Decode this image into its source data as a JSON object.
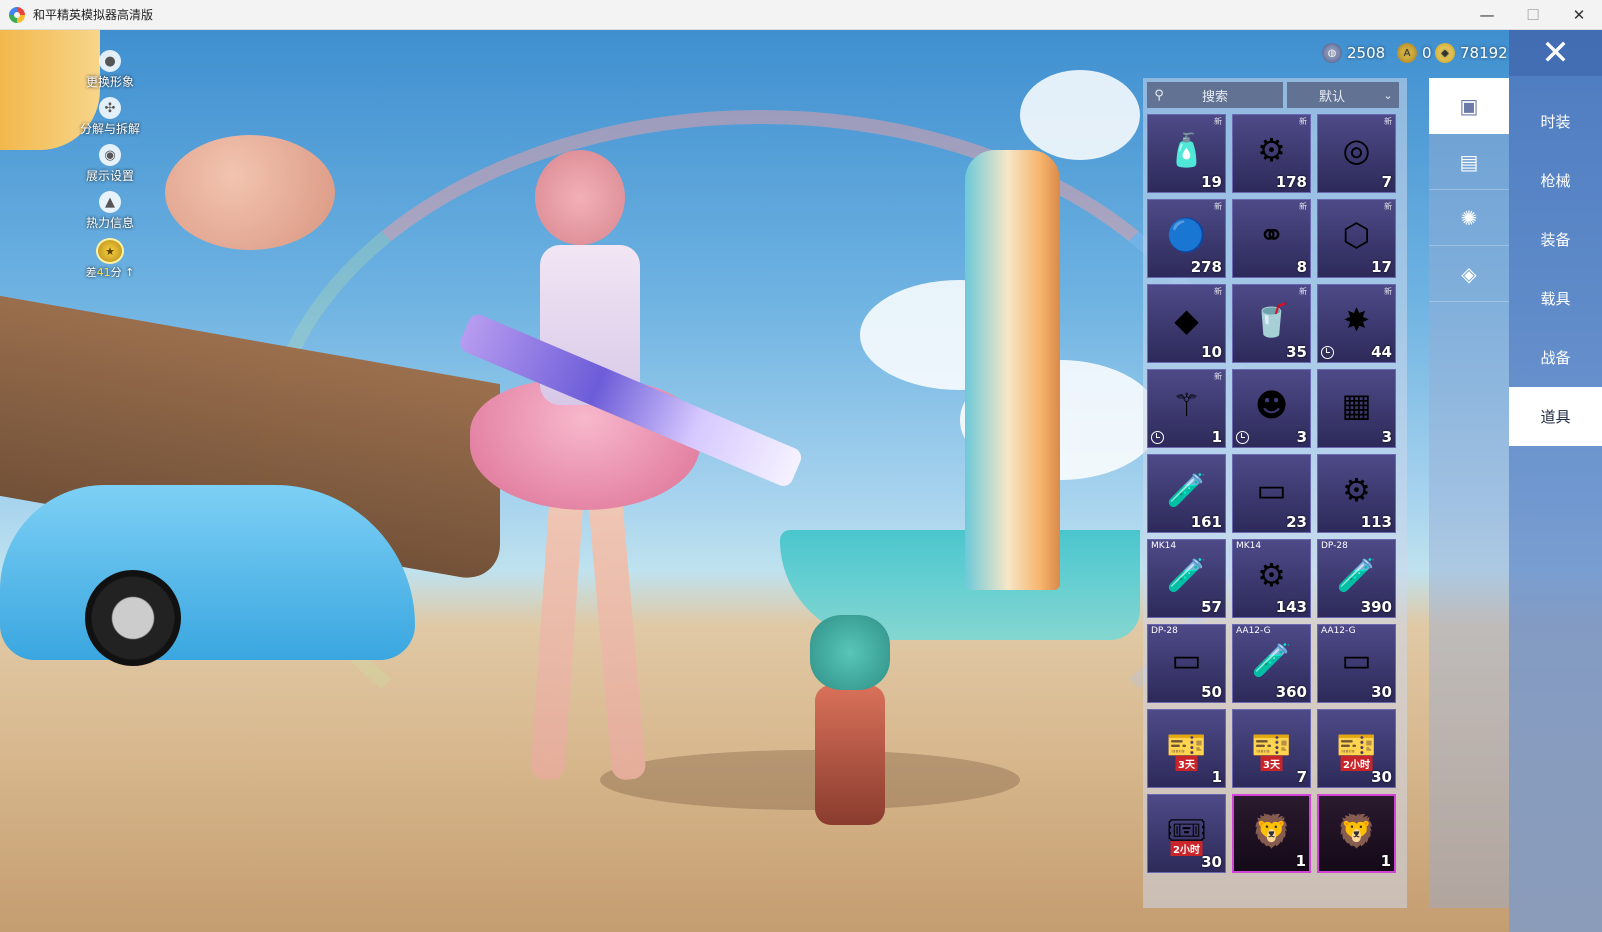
{
  "window": {
    "title": "和平精英模拟器高清版"
  },
  "side_menu": {
    "items": [
      {
        "label": "更换形象"
      },
      {
        "label": "分解与拆解"
      },
      {
        "label": "展示设置"
      },
      {
        "label": "热力信息"
      }
    ],
    "level": {
      "prefix": "差",
      "value": "41",
      "suffix": "分 ↑"
    }
  },
  "currency": [
    {
      "icon": "globe-coin-icon",
      "value": "2508"
    },
    {
      "icon": "a-coin-icon",
      "value": "0"
    },
    {
      "icon": "gold-coin-icon",
      "value": "78192"
    }
  ],
  "inventory": {
    "search_placeholder": "搜索",
    "sort_value": "默认",
    "new_tag": "新",
    "items": [
      {
        "icon": "spray-can-icon",
        "qty": "19",
        "new": true
      },
      {
        "icon": "spring-icon",
        "qty": "178",
        "new": true
      },
      {
        "icon": "dial-icon",
        "qty": "7",
        "new": true
      },
      {
        "icon": "puzzle-orb-icon",
        "qty": "278",
        "new": true
      },
      {
        "icon": "rings-icon",
        "qty": "8",
        "new": true
      },
      {
        "icon": "hex-gem-icon",
        "qty": "17",
        "new": true
      },
      {
        "icon": "diamond-icon",
        "qty": "10",
        "new": true
      },
      {
        "icon": "drink-can-icon",
        "qty": "35",
        "new": true
      },
      {
        "icon": "star-badge-icon",
        "qty": "44",
        "new": true,
        "timed": true
      },
      {
        "icon": "wand-icon",
        "qty": "1",
        "new": true,
        "timed": true
      },
      {
        "icon": "pink-figure-icon",
        "qty": "3",
        "timed": true
      },
      {
        "icon": "crate-icon",
        "qty": "3"
      },
      {
        "icon": "green-can-icon",
        "qty": "161"
      },
      {
        "icon": "tray-icon",
        "qty": "23"
      },
      {
        "icon": "spring-icon",
        "qty": "113"
      },
      {
        "icon": "green-can-icon",
        "qty": "57",
        "tag": "MK14"
      },
      {
        "icon": "spring-icon",
        "qty": "143",
        "tag": "MK14"
      },
      {
        "icon": "green-can-icon",
        "qty": "390",
        "tag": "DP-28"
      },
      {
        "icon": "tray-icon",
        "qty": "50",
        "tag": "DP-28"
      },
      {
        "icon": "green-can-icon",
        "qty": "360",
        "tag": "AA12-G"
      },
      {
        "icon": "tray-icon",
        "qty": "30",
        "tag": "AA12-G"
      },
      {
        "icon": "exp-card-icon",
        "qty": "1",
        "caption": "3天"
      },
      {
        "icon": "exp-card-icon",
        "qty": "7",
        "caption": "3天"
      },
      {
        "icon": "exp-card-icon",
        "qty": "30",
        "caption": "2小时"
      },
      {
        "icon": "coin-card-icon",
        "qty": "30",
        "caption": "2小时"
      },
      {
        "icon": "lion-emblem-icon",
        "qty": "1",
        "rare": true
      },
      {
        "icon": "lion-emblem-icon",
        "qty": "1",
        "rare": true
      }
    ]
  },
  "category_tabs": [
    {
      "icon": "card-icon",
      "active": true
    },
    {
      "icon": "chest-icon"
    },
    {
      "icon": "burst-icon"
    },
    {
      "icon": "ticket-icon"
    }
  ],
  "rail": {
    "close_label": "✕",
    "items": [
      {
        "label": "时装"
      },
      {
        "label": "枪械"
      },
      {
        "label": "装备"
      },
      {
        "label": "载具"
      },
      {
        "label": "战备"
      },
      {
        "label": "道具",
        "active": true
      }
    ]
  },
  "colors": {
    "rare_border": "#d045d6",
    "panel_tint": "#cdd7eb",
    "rail_blue": "#5078be"
  }
}
